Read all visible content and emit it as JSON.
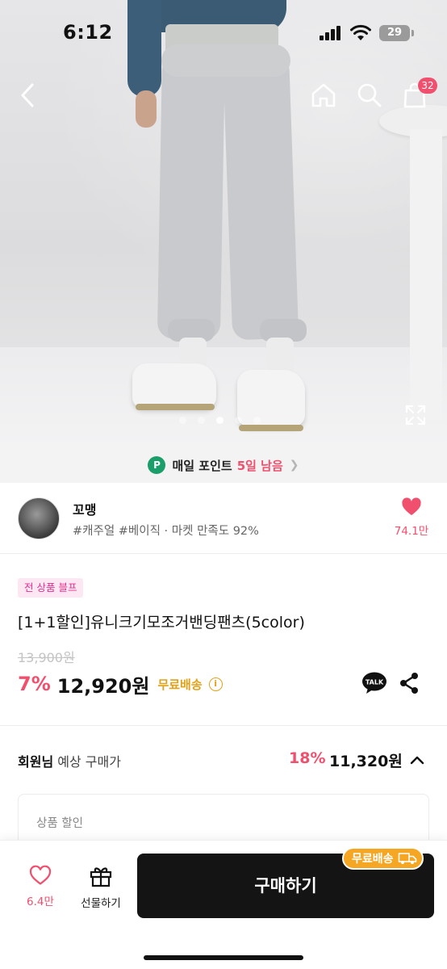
{
  "status_bar": {
    "time": "6:12",
    "battery": "29"
  },
  "nav": {
    "cart_count": "32"
  },
  "gallery": {
    "total_images": 5,
    "active_index": 3
  },
  "points_banner": {
    "icon": "P",
    "label": "매일 포인트",
    "days_left": "5일 남음"
  },
  "shop": {
    "name": "꼬맹",
    "tags": "#캐주얼 #베이직 · 마켓 만족도 92%",
    "likes": "74.1만"
  },
  "product": {
    "badge": "전 상품 블프",
    "title": "[1+1할인]유니크기모조거밴딩팬츠(5color)",
    "original_price": "13,900원",
    "discount": "7%",
    "price": "12,920원",
    "shipping": "무료배송"
  },
  "member_price": {
    "label_bold": "회원님",
    "label_rest": " 예상 구매가",
    "discount": "18%",
    "price": "11,320원"
  },
  "discount_section": {
    "title": "상품 할인"
  },
  "bottom_bar": {
    "wish_count": "6.4만",
    "gift_label": "선물하기",
    "buy_label": "구매하기",
    "free_shipping_pill": "무료배송"
  },
  "colors": {
    "accent": "#f0506e",
    "shipping": "#e0a21a",
    "points_green": "#1a9e6a",
    "buy_bg": "#141414"
  }
}
